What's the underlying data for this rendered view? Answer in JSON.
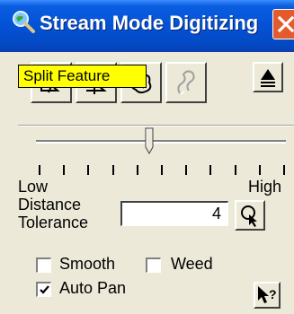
{
  "window": {
    "title": "Stream Mode Digitizing",
    "title_icon": "magnifier-globe-icon",
    "close_icon": "close-icon"
  },
  "toolbar": {
    "buttons": [
      {
        "name": "digitize-tool",
        "icon": "polygon-pen-icon",
        "enabled": true
      },
      {
        "name": "split-tool",
        "icon": "split-line-icon",
        "enabled": true
      },
      {
        "name": "freehand-tool",
        "icon": "freehand-shape-icon",
        "enabled": true
      },
      {
        "name": "stream-tool",
        "icon": "stream-path-icon",
        "enabled": false
      }
    ],
    "collapse_icon": "eject-icon"
  },
  "tooltip": {
    "text": "Split Feature"
  },
  "slider": {
    "low_label": "Low",
    "high_label": "High",
    "value_fraction": 0.45
  },
  "distance": {
    "label_line1": "Distance",
    "label_line2": "Tolerance",
    "value": "4",
    "pick_icon": "magnifier-pointer-icon"
  },
  "options": {
    "smooth": {
      "label": "Smooth",
      "checked": false
    },
    "weed": {
      "label": "Weed",
      "checked": false
    },
    "autopan": {
      "label": "Auto Pan",
      "checked": true
    }
  },
  "help_icon": "context-help-icon",
  "colors": {
    "titlebar": "#0453d6",
    "close": "#e35a2c",
    "face": "#ece9d8",
    "tooltip": "#ffff00"
  }
}
